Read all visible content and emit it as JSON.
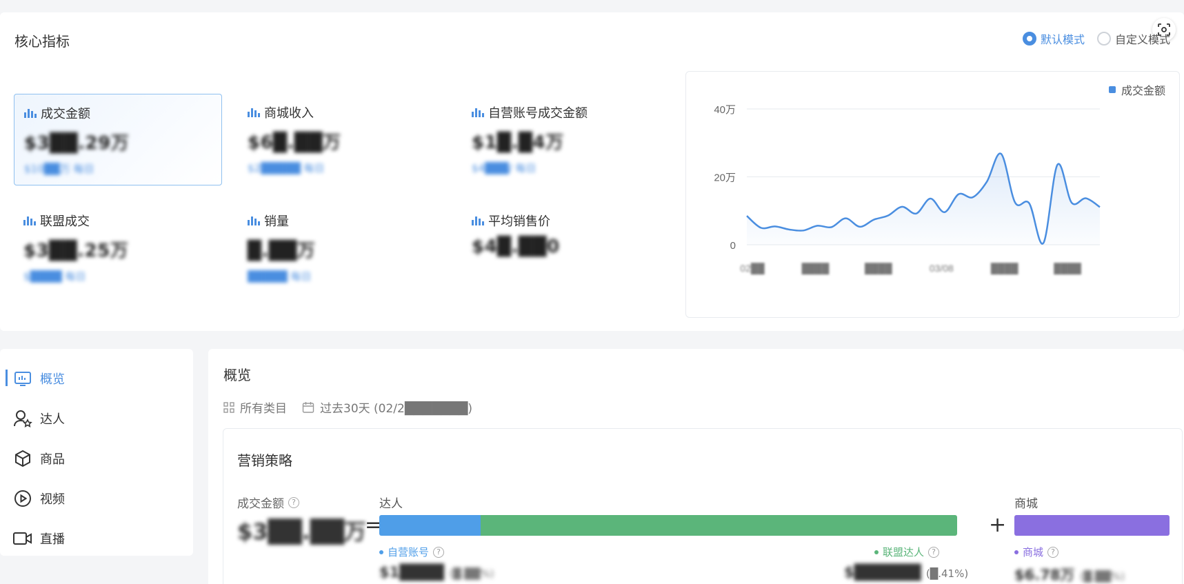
{
  "core": {
    "title": "核心指标",
    "modes": [
      {
        "label": "默认模式",
        "selected": true
      },
      {
        "label": "自定义模式",
        "selected": false
      }
    ],
    "metrics": [
      {
        "label": "成交金额",
        "value": "$3██.29万",
        "sub": "$10██万 每日",
        "selected": true
      },
      {
        "label": "商城收入",
        "value": "$6█.██万",
        "sub": "$2█████ 每日",
        "selected": false
      },
      {
        "label": "自营账号成交金额",
        "value": "$1█.█4万",
        "sub": "$4███/ 每日",
        "selected": false
      },
      {
        "label": "联盟成交",
        "value": "$3██.25万",
        "sub": "$████ 每日",
        "selected": false
      },
      {
        "label": "销量",
        "value": "█.██万",
        "sub": "█████ 每日",
        "selected": false
      },
      {
        "label": "平均销售价",
        "value": "$4█.██0",
        "sub": "",
        "selected": false
      }
    ],
    "legend": "成交金额",
    "accent": "#4a8ee0"
  },
  "chart_data": {
    "type": "area",
    "series": [
      {
        "name": "成交金额",
        "values": [
          8.5,
          5,
          5.4,
          4.5,
          4.2,
          5.6,
          5.2,
          7.8,
          5.3,
          7.4,
          8.6,
          11.2,
          9.2,
          13.6,
          9.6,
          14.9,
          14,
          18.6,
          26.8,
          12.4,
          12.2,
          0.5,
          23.6,
          12.4,
          13.7,
          11.1
        ]
      }
    ],
    "x": [
      "02██",
      "",
      "████",
      "",
      "████",
      "",
      "████",
      "",
      "03/08",
      "",
      "████",
      "",
      "████",
      "",
      "",
      "",
      "",
      "",
      "",
      "",
      "",
      "",
      "",
      "",
      "",
      ""
    ],
    "xticks": [
      "02██",
      "████",
      "████",
      "03/08",
      "████",
      "████"
    ],
    "yticks": [
      "40万",
      "20万",
      "0"
    ],
    "ylim": [
      0,
      40
    ],
    "grid": true,
    "legend_position": "top-right"
  },
  "nav": {
    "items": [
      {
        "label": "概览",
        "icon": "overview-icon",
        "active": true
      },
      {
        "label": "达人",
        "icon": "creator-icon",
        "active": false
      },
      {
        "label": "商品",
        "icon": "product-icon",
        "active": false
      },
      {
        "label": "视频",
        "icon": "video-icon",
        "active": false
      },
      {
        "label": "直播",
        "icon": "live-icon",
        "active": false
      }
    ]
  },
  "overview": {
    "title": "概览",
    "filter_category": "所有类目",
    "filter_date": "过去30天 (02/2███████)",
    "strategy": {
      "title": "营销策略",
      "gmv_label": "成交金额",
      "gmv_value": "$3██.██万",
      "eq": "=",
      "plus": "+",
      "creator_group": "达人",
      "mall_group": "商城",
      "self_label": "自营账号",
      "self_value": "$1████",
      "self_pct": "(█.██%)",
      "alliance_label": "联盟达人",
      "alliance_value": "$██████",
      "alliance_pct": "(█.41%)",
      "mall_label": "商城",
      "mall_value": "$6.78万",
      "mall_pct": "(█.██%)",
      "self_share": 0.175,
      "alliance_share": 0.825,
      "colors": {
        "self": "#4f9ee8",
        "alliance": "#5bb57a",
        "mall": "#8a6fe0"
      }
    }
  }
}
